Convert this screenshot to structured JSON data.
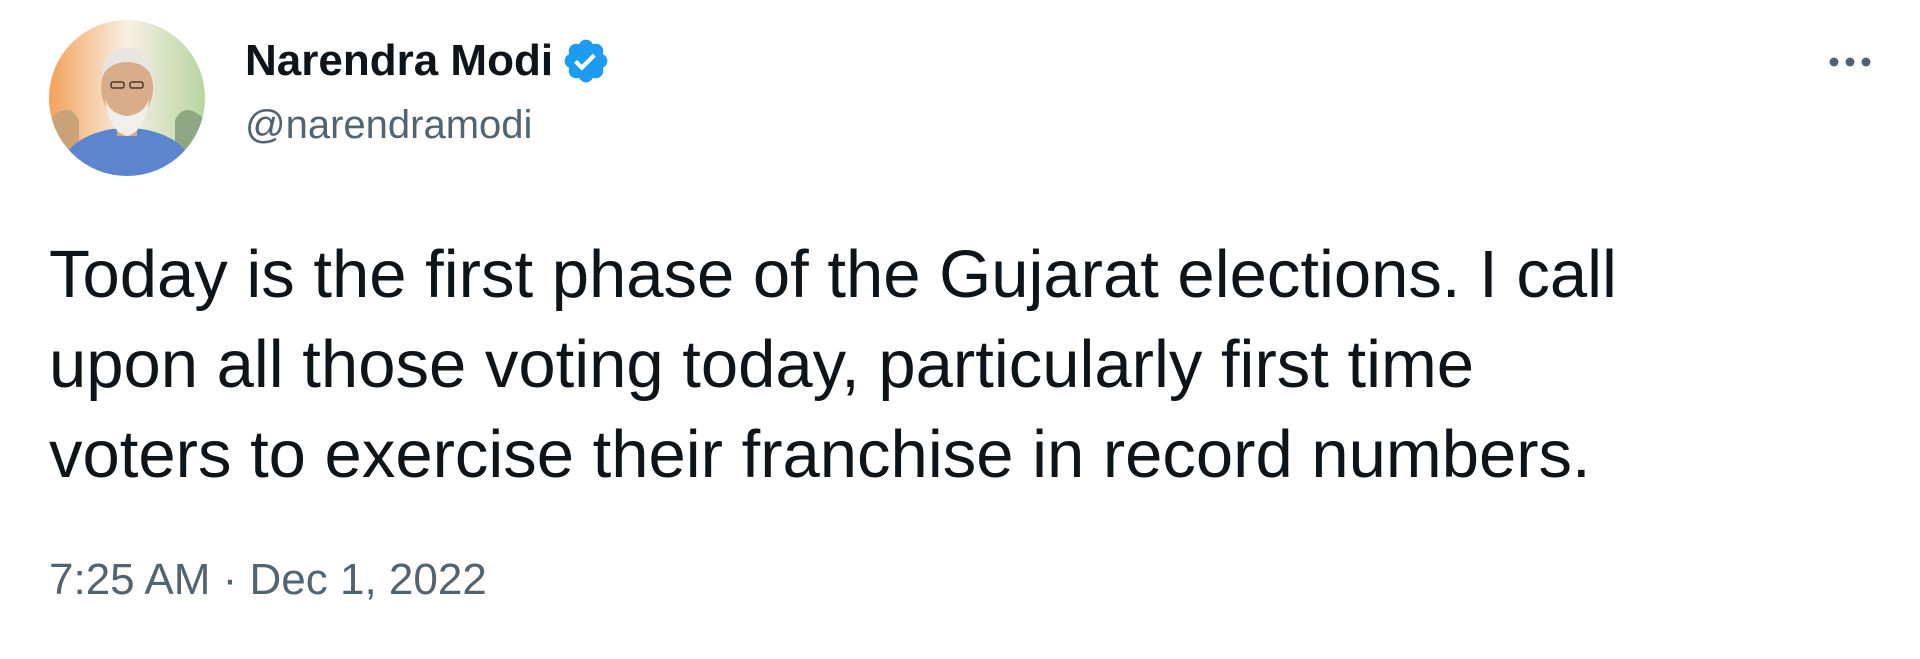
{
  "author": {
    "display_name": "Narendra Modi",
    "handle": "@narendramodi",
    "verified": true,
    "avatar_icon": "profile-photo"
  },
  "tweet": {
    "text_lines": [
      "Today is the first phase of the Gujarat elections. I call",
      "upon all those voting today, particularly first time",
      "voters to exercise their franchise in record numbers."
    ],
    "timestamp": "7:25 AM · Dec 1, 2022"
  },
  "icons": {
    "verified": "verified-badge-icon",
    "more": "more-options-icon"
  },
  "colors": {
    "text_primary": "#0f1419",
    "text_secondary": "#536471",
    "verified_blue": "#1d9bf0",
    "background": "#ffffff"
  }
}
